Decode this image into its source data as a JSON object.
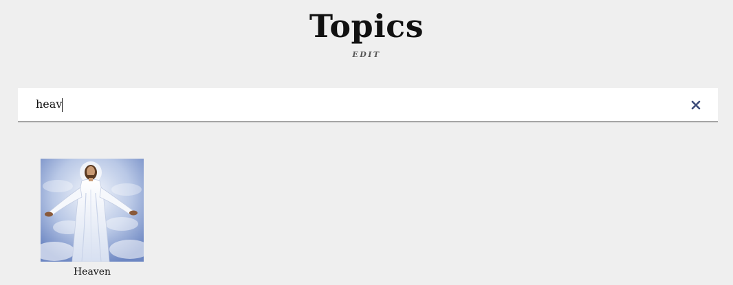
{
  "page": {
    "title": "Topics",
    "edit_label": "EDIT"
  },
  "search": {
    "value": "heav",
    "placeholder": "",
    "clear_icon": "close-icon",
    "clear_color": "#3b4a78"
  },
  "results": [
    {
      "label": "Heaven",
      "image": "topic-thumbnail-heaven"
    }
  ],
  "colors": {
    "background": "#efefef",
    "text": "#111111",
    "edit": "#555555",
    "accent": "#3b4a78"
  }
}
